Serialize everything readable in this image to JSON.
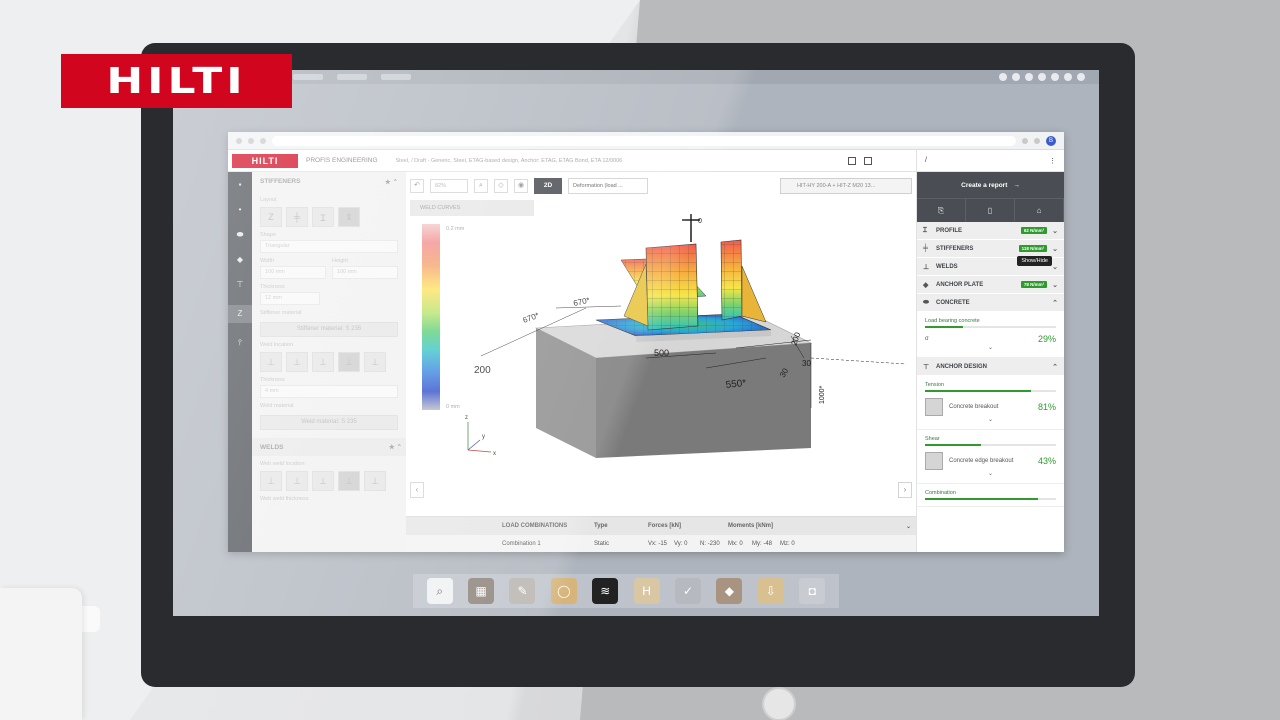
{
  "brand": {
    "logo_text": "HILTI",
    "color": "#d2051e"
  },
  "app": {
    "logo_text": "HILTI",
    "product_name": "PROFIS ENGINEERING",
    "breadcrumb": "Steel, / Draft - Generic, Steel, ETAG-based design, Anchor: ETAG, ETAG Bond, ETA 12/0006",
    "right_header": "/"
  },
  "left_panel": {
    "stiffeners_title": "STIFFENERS",
    "layout_label": "Layout",
    "shape_label": "Shape",
    "shape_value": "Triangular",
    "width_label": "Width",
    "height_label": "Height",
    "width_value": "100 mm",
    "height_value": "100 mm",
    "thickness_label": "Thickness",
    "thickness_value": "12 mm",
    "stiffener_material_label": "Stiffener material",
    "stiffener_material_btn": "Stiffener material: S 235",
    "weld_location_label": "Weld location",
    "weld_thickness_label": "Thickness",
    "weld_thickness_value": "4 mm",
    "weld_material_label": "Weld material",
    "weld_material_btn": "Weld material: S 235",
    "welds_title": "WELDS",
    "web_weld_location_label": "Web weld location",
    "web_weld_thickness_label": "Web weld thickness"
  },
  "toolbar": {
    "zoom_value": "82%",
    "view_2d": "2D",
    "deformation_select": "Deformation (load ...",
    "anchor_select": "HIT-HY 200-A + HIT-Z M20 13...",
    "weld_curves": "WELD CURVES"
  },
  "legend": {
    "top": "0.2 mm",
    "bottom": "0 mm"
  },
  "model": {
    "dim_670_a": "670*",
    "dim_670_b": "670*",
    "dim_200": "200",
    "dim_500": "500",
    "dim_550": "550*",
    "dim_30_a": "30",
    "dim_30_b": "30",
    "dim_200_b": "200",
    "dim_1000": "1000*",
    "load_zero": "0",
    "axis_z": "z",
    "axis_y": "y",
    "axis_x": "x"
  },
  "load_table": {
    "headers": [
      "LOAD COMBINATIONS",
      "Type",
      "Forces [kN]",
      "Moments [kNm]"
    ],
    "row": {
      "name": "Combination 1",
      "type": "Static",
      "vx": "Vx: -15",
      "vy": "Vy: 0",
      "n": "N: -230",
      "mx": "Mx: 0",
      "my": "My: -48",
      "mz": "Mz: 0"
    }
  },
  "right_panel": {
    "create_report": "Create a report",
    "items": [
      {
        "label": "PROFILE",
        "badge": "62 N/mm²"
      },
      {
        "label": "STIFFENERS",
        "badge": "118 N/mm²"
      },
      {
        "label": "WELDS",
        "badge": ""
      },
      {
        "label": "ANCHOR PLATE",
        "badge": "78 N/mm²"
      },
      {
        "label": "CONCRETE",
        "badge": ""
      }
    ],
    "tooltip": "Show/Hide",
    "concrete": {
      "sub": "Load bearing concrete",
      "symbol": "σ",
      "pct": "29%",
      "fill": 0.29
    },
    "anchor_design_title": "ANCHOR DESIGN",
    "tension": {
      "sub": "Tension",
      "label": "Concrete breakout",
      "pct": "81%",
      "fill": 0.81
    },
    "shear": {
      "sub": "Shear",
      "label": "Concrete edge breakout",
      "pct": "43%",
      "fill": 0.43
    },
    "combination_sub": "Combination"
  },
  "colors": {
    "accent_green": "#2f9b2f",
    "dark_panel": "#4a4e54"
  }
}
